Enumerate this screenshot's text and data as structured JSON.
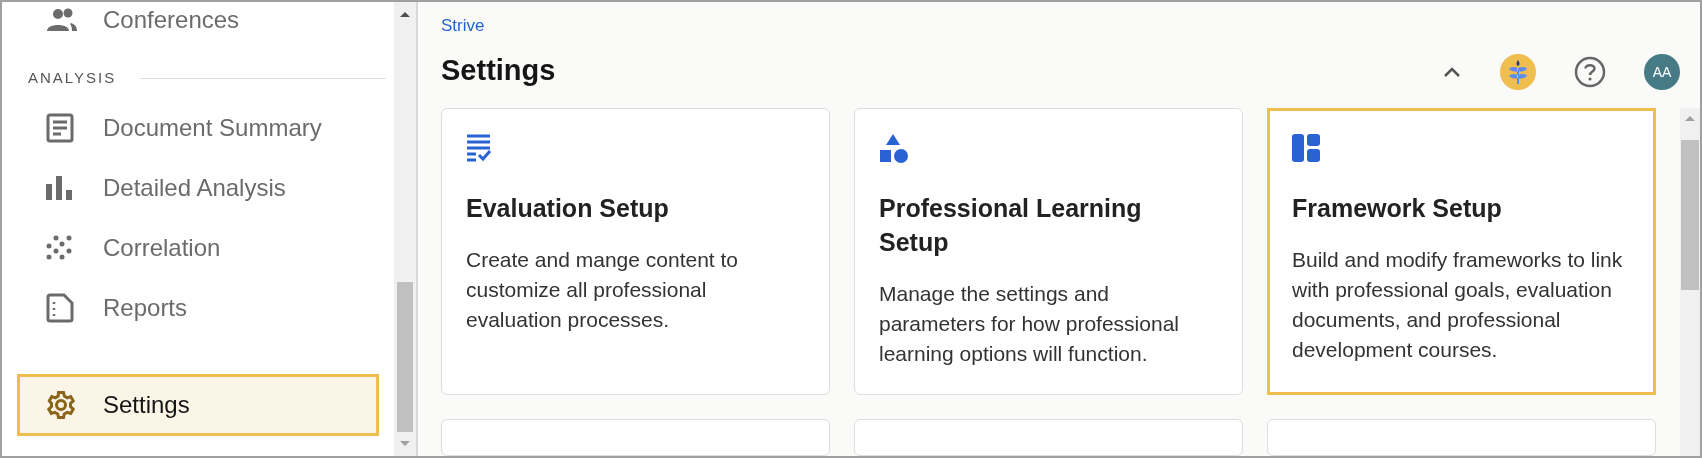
{
  "sidebar": {
    "items": [
      {
        "label": "Conferences",
        "kind": "people",
        "selected": false
      },
      {
        "kind": "section",
        "label": "ANALYSIS"
      },
      {
        "label": "Document Summary",
        "kind": "document",
        "selected": false
      },
      {
        "label": "Detailed Analysis",
        "kind": "bars",
        "selected": false
      },
      {
        "label": "Correlation",
        "kind": "dots",
        "selected": false
      },
      {
        "label": "Reports",
        "kind": "report",
        "selected": false
      },
      {
        "kind": "spacer"
      },
      {
        "label": "Settings",
        "kind": "gear",
        "selected": true
      }
    ]
  },
  "breadcrumb": "Strive",
  "title": "Settings",
  "header": {
    "avatar": "AA"
  },
  "cards": [
    {
      "kind": "checklist",
      "title": "Evaluation Setup",
      "description": "Create and mange content to customize all professional evaluation processes.",
      "selected": false
    },
    {
      "kind": "shapes",
      "title": "Professional Learning Setup",
      "description": "Manage the settings and parameters for how professional learning options will function.",
      "selected": false
    },
    {
      "kind": "layout",
      "title": "Framework Setup",
      "description": "Build and modify frameworks to link with professional goals, evaluation documents, and professional development courses.",
      "selected": true
    }
  ]
}
